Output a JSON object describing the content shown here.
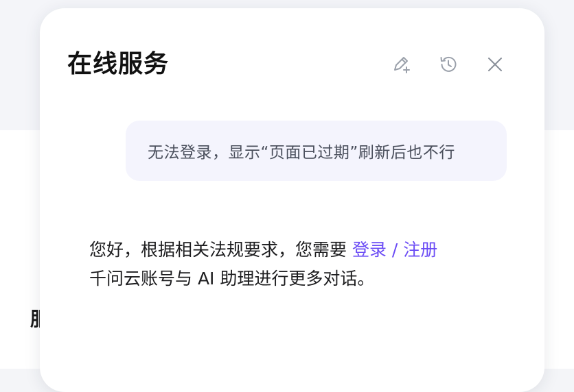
{
  "backdrop": {
    "partial_glyph": "服"
  },
  "panel": {
    "title": "在线服务",
    "actions": [
      {
        "name": "new-chat",
        "icon": "edit-plus-icon"
      },
      {
        "name": "history",
        "icon": "history-icon"
      },
      {
        "name": "close",
        "icon": "close-icon"
      }
    ]
  },
  "conversation": {
    "user_message": "无法登录，显示“页面已过期”刷新后也不行",
    "assistant_message": {
      "line1_prefix": "您好，根据相关法规要求，您需要 ",
      "login_link": "登录 / 注册",
      "line2": "千问云账号与 AI 助理进行更多对话。"
    }
  },
  "colors": {
    "link": "#6b4cf5",
    "user_bubble_bg": "#f4f4fd",
    "icon": "#9aa0aa"
  }
}
